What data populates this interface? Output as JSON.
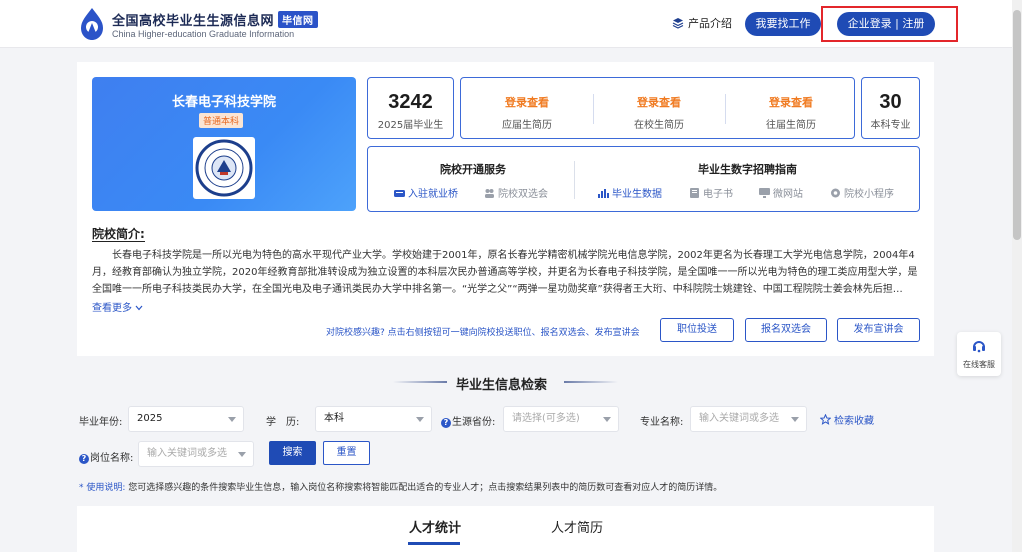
{
  "header": {
    "logo_title": "全国高校毕业生生源信息网",
    "logo_badge": "毕信网",
    "logo_subtitle": "China Higher-education Graduate Information",
    "nav_product": "产品介绍",
    "find_job_btn": "我要找工作",
    "login_btn": "企业登录 | 注册"
  },
  "school": {
    "name": "长春电子科技学院",
    "type": "普通本科",
    "seal_text": "長春電子科技學院"
  },
  "stats": {
    "graduates": {
      "value": "3242",
      "label": "2025届毕业生"
    },
    "majors": {
      "value": "30",
      "label": "本科专业"
    }
  },
  "resume": [
    {
      "action": "登录查看",
      "label": "应届生简历"
    },
    {
      "action": "登录查看",
      "label": "在校生简历"
    },
    {
      "action": "登录查看",
      "label": "往届生简历"
    }
  ],
  "services": {
    "left_title": "院校开通服务",
    "right_title": "毕业生数字招聘指南",
    "left_items": [
      "入驻就业桥",
      "院校双选会"
    ],
    "right_items": [
      "毕业生数据",
      "电子书",
      "微网站",
      "院校小程序"
    ]
  },
  "intro": {
    "title": "院校简介:",
    "body": "长春电子科技学院是一所以光电为特色的高水平现代产业大学。学校始建于2001年，原名长春光学精密机械学院光电信息学院，2002年更名为长春理工大学光电信息学院，2004年4月，经教育部确认为独立学院，2020年经教育部批准转设成为独立设置的本科层次民办普通高等学校，并更名为长春电子科技学院，是全国唯一一所以光电为特色的理工类应用型大学，是全国唯一一所电子科技类民办大学，在全国光电及电子通讯类民办大学中排名第一。“光学之父”“两弹一星功勋奖章”获得者王大珩、中科院院士姚建铨、中国工程院院士姜会林先后担…",
    "more": "查看更多"
  },
  "actions": {
    "hint": "对院校感兴趣? 点击右侧按钮可一键向院校投送职位、报名双选会、发布宣讲会",
    "buttons": [
      "职位投送",
      "报名双选会",
      "发布宣讲会"
    ]
  },
  "search": {
    "title": "毕业生信息检索",
    "year_label": "毕业年份:",
    "year_value": "2025",
    "edu_label": "学　历:",
    "edu_value": "本科",
    "origin_label": "生源省份:",
    "origin_placeholder": "请选择(可多选)",
    "major_label": "专业名称:",
    "major_placeholder": "输入关键词或多选",
    "fav": "检索收藏",
    "job_label": "岗位名称:",
    "job_placeholder": "输入关键词或多选",
    "search_btn": "搜索",
    "reset_btn": "重置",
    "usage_key": "* 使用说明:",
    "usage_text": "您可选择感兴趣的条件搜索毕业生信息，输入岗位名称搜索将智能匹配出适合的专业人才；点击搜索结果列表中的简历数可查看对应人才的简历详情。"
  },
  "tabs": [
    "人才统计",
    "人才简历"
  ],
  "customer_service": "在线客服",
  "colors": {
    "brand": "#1f4bb5",
    "accent_orange": "#f07b22",
    "highlight_red": "#e3262b"
  }
}
